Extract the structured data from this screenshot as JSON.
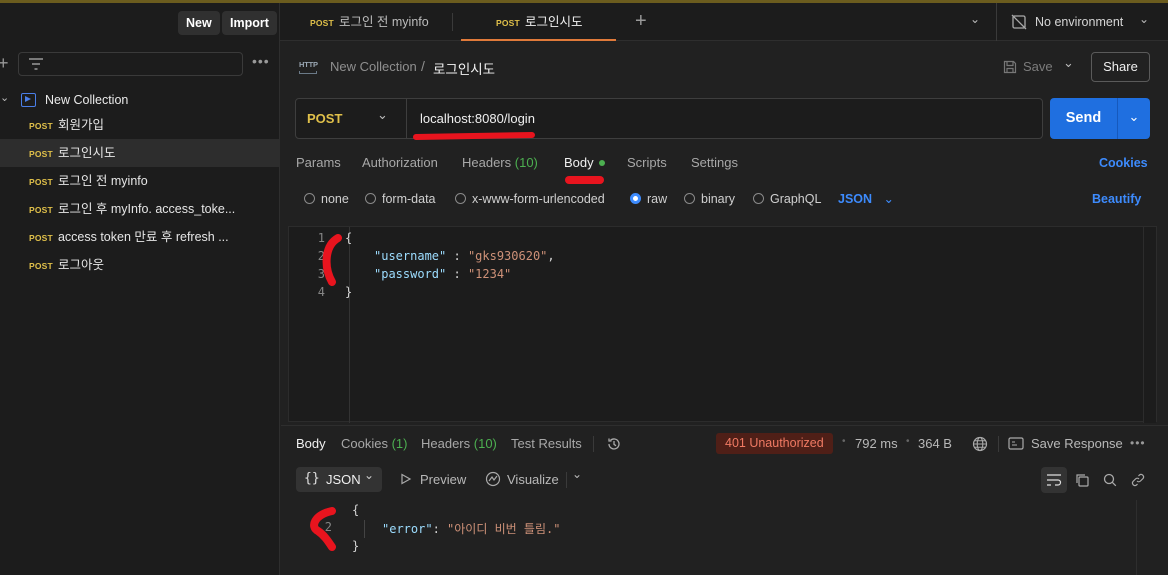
{
  "sidebar": {
    "new_label": "New",
    "import_label": "Import",
    "collection_name": "New Collection",
    "items": [
      {
        "method": "POST",
        "label": "회원가입"
      },
      {
        "method": "POST",
        "label": "로그인시도"
      },
      {
        "method": "POST",
        "label": "로그인 전 myinfo"
      },
      {
        "method": "POST",
        "label": "로그인 후 myInfo. access_toke..."
      },
      {
        "method": "POST",
        "label": "access token 만료 후 refresh ..."
      },
      {
        "method": "POST",
        "label": "로그아웃"
      }
    ]
  },
  "tabs": [
    {
      "method": "POST",
      "label": "로그인 전 myinfo"
    },
    {
      "method": "POST",
      "label": "로그인시도"
    }
  ],
  "environment": "No environment",
  "breadcrumb": {
    "collection": "New Collection",
    "separator": "/",
    "request": "로그인시도"
  },
  "header_actions": {
    "save": "Save",
    "share": "Share"
  },
  "request": {
    "method": "POST",
    "url": "localhost:8080/login",
    "send_label": "Send",
    "subtabs": {
      "params": "Params",
      "authorization": "Authorization",
      "headers": "Headers",
      "headers_count": "(10)",
      "body": "Body",
      "scripts": "Scripts",
      "settings": "Settings",
      "cookies": "Cookies"
    },
    "body_modes": [
      "none",
      "form-data",
      "x-www-form-urlencoded",
      "raw",
      "binary",
      "GraphQL"
    ],
    "selected_body_mode": "raw",
    "format": "JSON",
    "beautify": "Beautify",
    "body_lines": {
      "l1": {
        "num": "1",
        "text": "{"
      },
      "l2": {
        "num": "2",
        "key": "\"username\"",
        "colon": " : ",
        "value": "\"gks930620\"",
        "trail": ","
      },
      "l3": {
        "num": "3",
        "key": "\"password\"",
        "colon": " : ",
        "value": "\"1234\""
      },
      "l4": {
        "num": "4",
        "text": "}"
      }
    }
  },
  "response": {
    "tabs": {
      "body": "Body",
      "cookies": "Cookies",
      "cookies_count": "(1)",
      "headers": "Headers",
      "headers_count": "(10)",
      "test_results": "Test Results"
    },
    "status": "401 Unauthorized",
    "time": "792 ms",
    "size": "364 B",
    "save_response": "Save Response",
    "format": "JSON",
    "preview": "Preview",
    "visualize": "Visualize",
    "body_lines": {
      "l1": {
        "text": "{"
      },
      "l2": {
        "num": "2",
        "key": "\"error\"",
        "colon": ": ",
        "value": "\"아이디 비번 틀림.\""
      },
      "l3": {
        "text": "}"
      }
    }
  },
  "colors": {
    "accent": "#1f6fe0",
    "post": "#e0c04a",
    "error": "#f07a63",
    "annotation": "#e8141e"
  }
}
